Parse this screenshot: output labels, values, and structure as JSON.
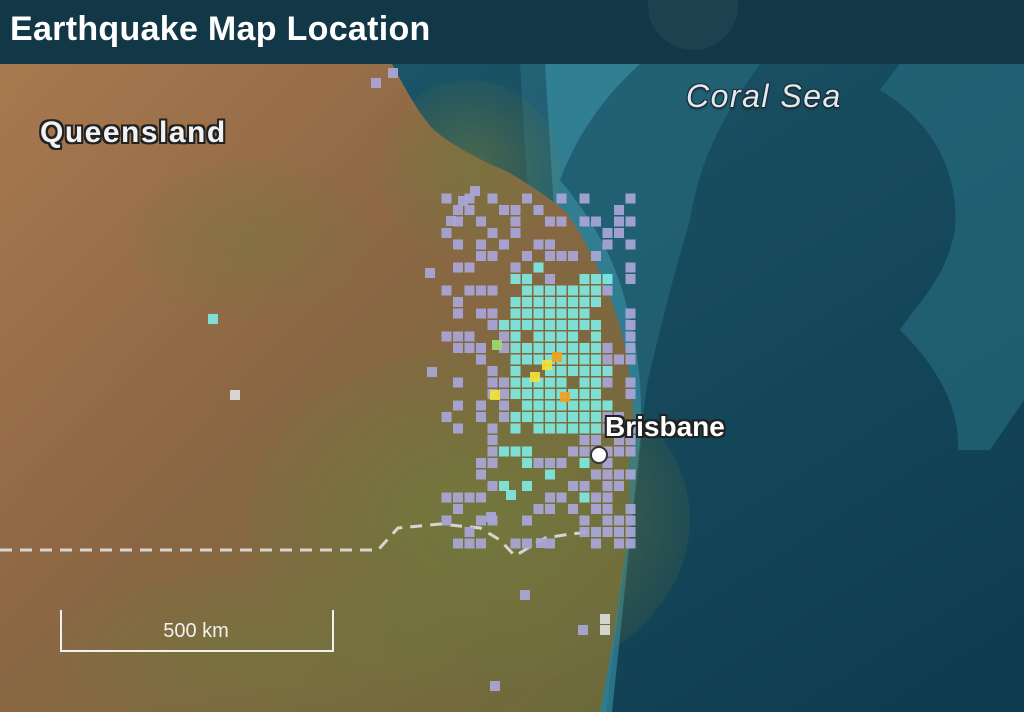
{
  "header": {
    "title": "Earthquake Map Location"
  },
  "map": {
    "region_label": "Queensland",
    "sea_label": "Coral Sea",
    "city": {
      "name": "Brisbane",
      "marker": "city-dot-icon"
    },
    "scale_bar": {
      "label": "500 km"
    },
    "colors": {
      "land": "#8f6a48",
      "sea": "#184f63",
      "deep_sea": "#0f3e52",
      "coast_shallow": "#3a8fa3",
      "header": "#123746",
      "intensity_low": "#a9a6d8",
      "intensity_weak": "#7fe9e2",
      "intensity_light": "#9fd86f",
      "intensity_moderate": "#f1e23a",
      "intensity_strong": "#f0a21e",
      "intensity_outlier": "#dcdcdc"
    }
  }
}
